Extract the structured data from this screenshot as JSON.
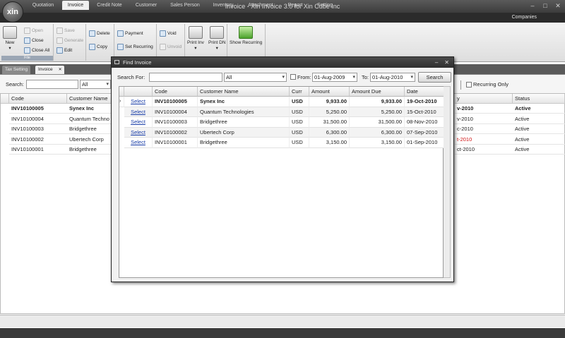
{
  "app": {
    "title": "Invoice - Xin Invoice 3.0 for Xin Cube Inc",
    "logo": "xin"
  },
  "menu_tabs": [
    "Quotation",
    "Invoice",
    "Credit Note",
    "Customer",
    "Sales Person",
    "Inventory",
    "Attachment",
    "Report",
    "Setting"
  ],
  "companies": "Companies",
  "ribbon": {
    "new": "New",
    "open": "Open",
    "close": "Close",
    "close_all": "Close All",
    "save": "Save",
    "generate": "Generate",
    "edit": "Edit",
    "delete": "Delete",
    "copy": "Copy",
    "payment": "Payment",
    "set_recurring": "Set Recurring",
    "void": "Void",
    "unvoid": "Unvoid",
    "print_inv": "Print Inv",
    "print_dn": "Print DN",
    "show_recurring": "Show Recurring",
    "file_group": "File"
  },
  "doc_tabs": [
    "Tax Setting",
    "Invoice"
  ],
  "main": {
    "search_label": "Search:",
    "filter_value": "All",
    "recurring_only": "Recurring Only",
    "columns": {
      "code": "Code",
      "customer": "Customer Name",
      "due": "y",
      "status": "Status"
    },
    "rows": [
      {
        "code": "INV10100005",
        "customer": "Synex Inc",
        "due": "v-2010",
        "status": "Active",
        "bold": true,
        "overdue": false
      },
      {
        "code": "INV10100004",
        "customer": "Quantum Techno",
        "due": "v-2010",
        "status": "Active",
        "bold": false,
        "overdue": false
      },
      {
        "code": "INV10100003",
        "customer": "Bridgethree",
        "due": "c-2010",
        "status": "Active",
        "bold": false,
        "overdue": false
      },
      {
        "code": "INV10100002",
        "customer": "Ubertech Corp",
        "due": "t-2010",
        "status": "Active",
        "bold": false,
        "overdue": true
      },
      {
        "code": "INV10100001",
        "customer": "Bridgethree",
        "due": "ct-2010",
        "status": "Active",
        "bold": false,
        "overdue": false
      }
    ]
  },
  "dialog": {
    "title": "Find Invoice",
    "search_for_label": "Search For:",
    "search_for_value": "",
    "scope": "All",
    "from_label": "From:",
    "from_date": "01-Aug-2009",
    "to_label": "To:",
    "to_date": "01-Aug-2010",
    "search_button": "Search",
    "columns": [
      "Code",
      "Customer Name",
      "Curr",
      "Amount",
      "Amount Due",
      "Date"
    ],
    "select_label": "Select",
    "rows": [
      {
        "code": "INV10100005",
        "customer": "Synex Inc",
        "curr": "USD",
        "amount": "9,933.00",
        "due": "9,933.00",
        "date": "19-Oct-2010"
      },
      {
        "code": "INV10100004",
        "customer": "Quantum Technologies",
        "curr": "USD",
        "amount": "5,250.00",
        "due": "5,250.00",
        "date": "15-Oct-2010"
      },
      {
        "code": "INV10100003",
        "customer": "Bridgethree",
        "curr": "USD",
        "amount": "31,500.00",
        "due": "31,500.00",
        "date": "08-Nov-2010"
      },
      {
        "code": "INV10100002",
        "customer": "Ubertech Corp",
        "curr": "USD",
        "amount": "6,300.00",
        "due": "6,300.00",
        "date": "07-Sep-2010"
      },
      {
        "code": "INV10100001",
        "customer": "Bridgethree",
        "curr": "USD",
        "amount": "3,150.00",
        "due": "3,150.00",
        "date": "01-Sep-2010"
      }
    ]
  }
}
